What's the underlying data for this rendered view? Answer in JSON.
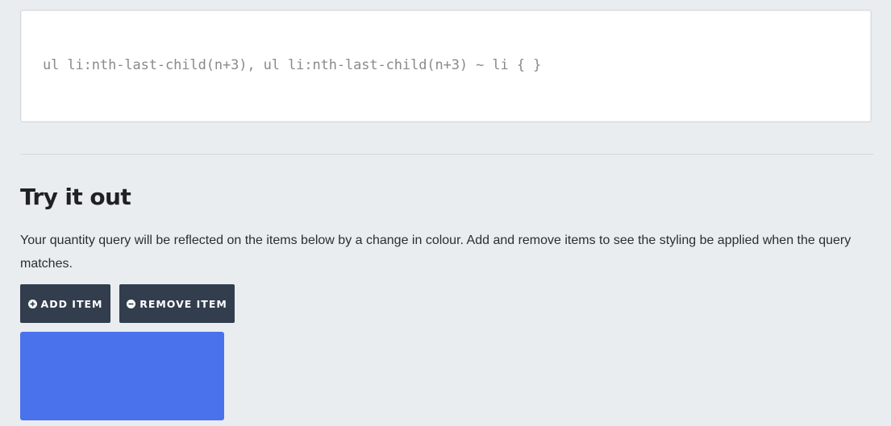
{
  "code": {
    "selector": "ul li:nth-last-child(n+3), ul li:nth-last-child(n+3) ~ li { }"
  },
  "section": {
    "title": "Try it out",
    "description": "Your quantity query will be reflected on the items below by a change in colour. Add and remove items to see the styling be applied when the query matches."
  },
  "buttons": {
    "add_label": "ADD ITEM",
    "add_icon": "plus-circle-icon",
    "remove_label": "REMOVE ITEM",
    "remove_icon": "minus-circle-icon"
  },
  "colors": {
    "button_bg": "#323d4d",
    "item_color": "#4a72ec",
    "background": "#eaedf0"
  },
  "items": [
    {
      "color": "#4a72ec"
    }
  ]
}
